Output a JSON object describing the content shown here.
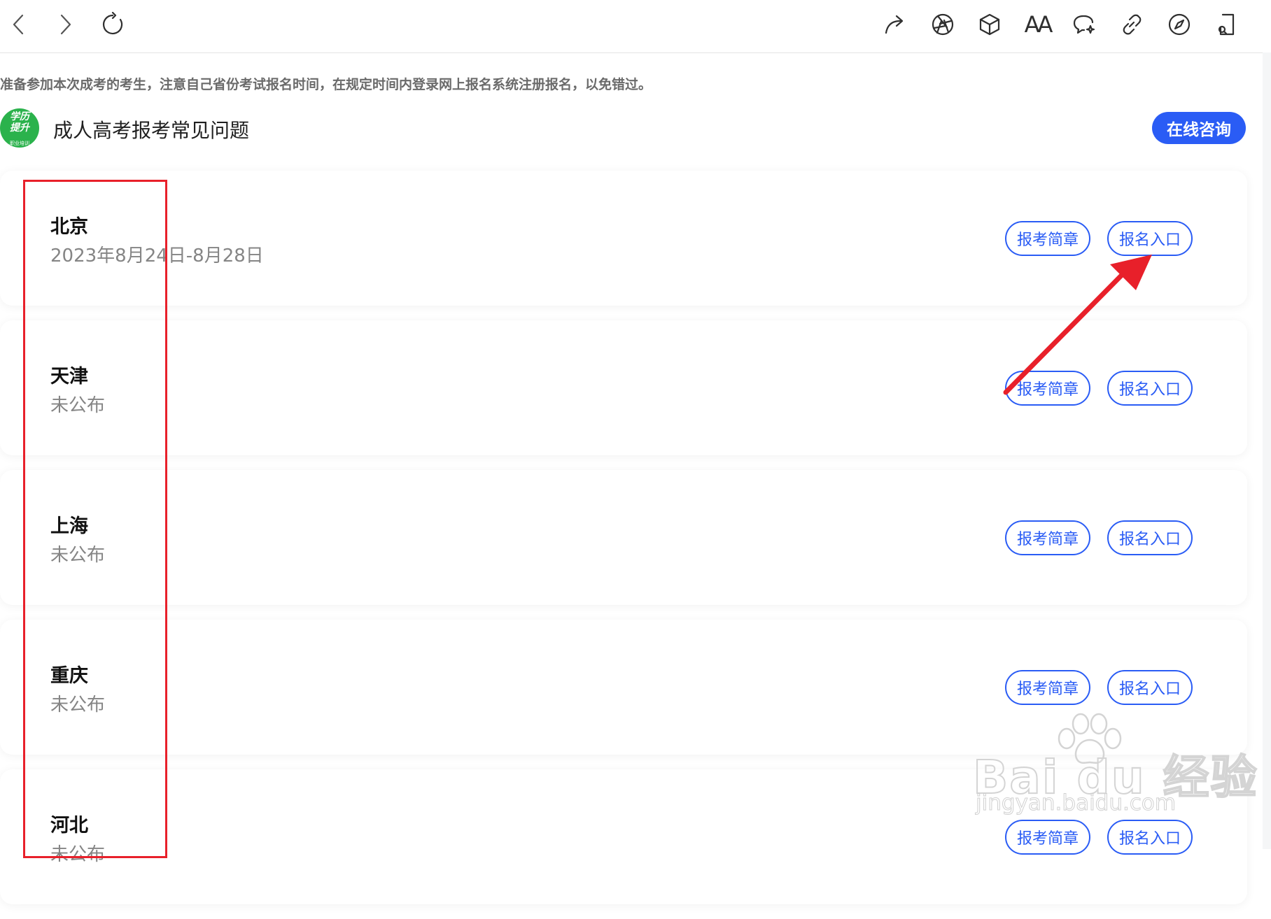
{
  "toolbar": {
    "left_icons": [
      "back-icon",
      "forward-icon",
      "refresh-icon"
    ],
    "right_icons": [
      "share-icon",
      "aperture-icon",
      "3d-box-icon",
      "text-size-icon",
      "chat-sparkle-icon",
      "link-icon",
      "compass-icon",
      "reader-icon"
    ],
    "text_size_glyph": "AA"
  },
  "page": {
    "notice": "准备参加本次成考的考生，注意自己省份考试报名时间，在规定时间内登录网上报名系统注册报名，以免错过。",
    "logo": {
      "line1": "学历",
      "line2": "提升",
      "sub": "职业培训"
    },
    "title": "成人高考报考常见问题",
    "consult_button": "在线咨询",
    "accent_color": "#2a5cf5"
  },
  "provinces": [
    {
      "name": "北京",
      "date": "2023年8月24日-8月28日",
      "brochure_label": "报考简章",
      "entry_label": "报名入口"
    },
    {
      "name": "天津",
      "date": "未公布",
      "brochure_label": "报考简章",
      "entry_label": "报名入口"
    },
    {
      "name": "上海",
      "date": "未公布",
      "brochure_label": "报考简章",
      "entry_label": "报名入口"
    },
    {
      "name": "重庆",
      "date": "未公布",
      "brochure_label": "报考简章",
      "entry_label": "报名入口"
    },
    {
      "name": "河北",
      "date": "未公布",
      "brochure_label": "报考简章",
      "entry_label": "报名入口"
    }
  ],
  "annotation": {
    "color": "#e8202a"
  },
  "watermark": {
    "main": "Bai du 经验",
    "sub": "jingyan.baidu.com"
  }
}
